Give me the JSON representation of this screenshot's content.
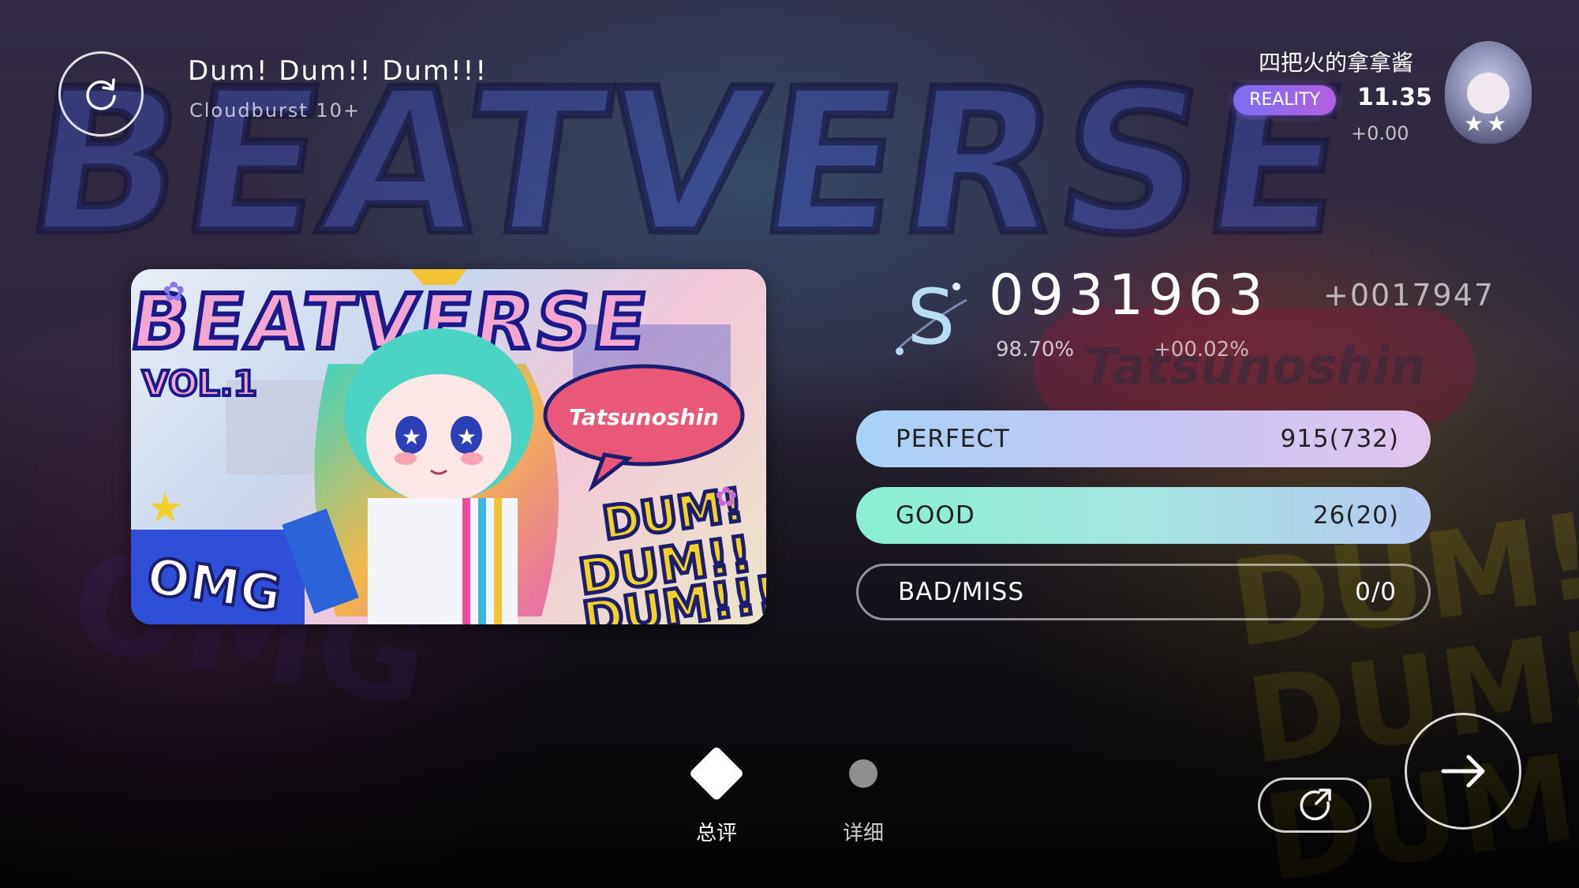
{
  "song": {
    "title": "Dum! Dum!! Dum!!!",
    "difficulty": "Cloudburst 10+"
  },
  "player": {
    "name": "四把火的拿拿酱",
    "badge": "REALITY",
    "rks": "11.35",
    "rks_delta": "+0.00",
    "avatar_stars": "★★"
  },
  "cover_art": {
    "title_text": "BEATVERSE",
    "vol_text": "VOL.1",
    "artist_bubble": "Tatsunoshin",
    "dum_lines": [
      "DUM!",
      "DUM!!",
      "DUM!!!"
    ],
    "omg_text": "OMG"
  },
  "result": {
    "rank": "S",
    "score": "0931963",
    "score_delta": "+0017947",
    "accuracy": "98.70%",
    "accuracy_delta": "+00.02%"
  },
  "judgements": [
    {
      "label": "PERFECT",
      "value": "915(732)"
    },
    {
      "label": "GOOD",
      "value": "26(20)"
    },
    {
      "label": "BAD/MISS",
      "value": "0/0"
    }
  ],
  "tabs": [
    {
      "label": "总评",
      "active": true
    },
    {
      "label": "详细",
      "active": false
    }
  ],
  "icons": {
    "retry": "retry-icon",
    "share": "share-icon",
    "next": "arrow-right-icon"
  },
  "colors": {
    "perfect_start": "#a8d3f6",
    "perfect_end": "#e2c5ef",
    "good_start": "#89f0d0",
    "good_end": "#b6c8f1",
    "reality_badge": "#9a66ee"
  }
}
